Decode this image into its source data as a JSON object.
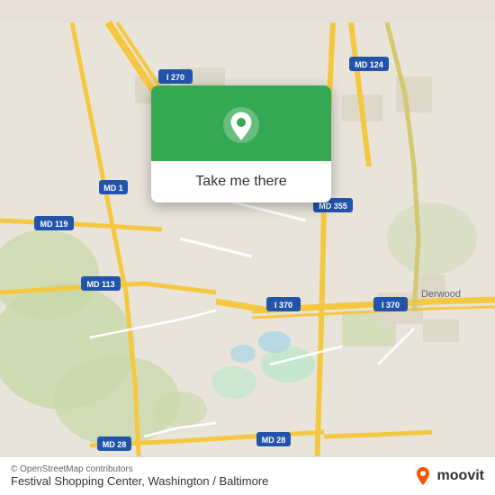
{
  "map": {
    "attribution": "© OpenStreetMap contributors",
    "title": "Festival Shopping Center, Washington / Baltimore",
    "bg_color": "#e8e4da"
  },
  "popup": {
    "button_label": "Take me there",
    "pin_icon": "location-pin-icon"
  },
  "footer": {
    "attribution": "© OpenStreetMap contributors",
    "title": "Festival Shopping Center, Washington / Baltimore",
    "moovit_text": "moovit"
  },
  "roads": {
    "highway_color": "#f5c842",
    "road_color": "#ffffff",
    "minor_color": "#f0ece0"
  }
}
